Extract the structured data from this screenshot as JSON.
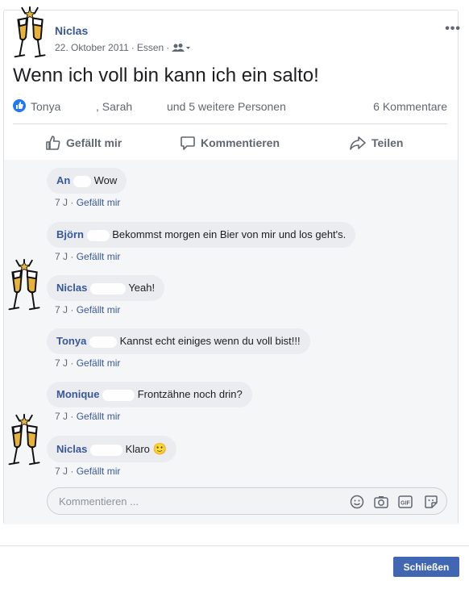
{
  "post": {
    "author": "Niclas",
    "date": "22. Oktober 2011",
    "place": "Essen",
    "audience_icon": "friends-icon",
    "text": "Wenn ich voll bin kann ich ein salto!",
    "more_label": "•••"
  },
  "reactions": {
    "name1": "Tonya",
    "name2": ", Sarah",
    "others": "und 5 weitere Personen",
    "comment_count": "6 Kommentare"
  },
  "actions": {
    "like": "Gefällt mir",
    "comment": "Kommentieren",
    "share": "Teilen"
  },
  "comments": [
    {
      "name": "An",
      "text": "Wow",
      "time": "7 J",
      "like": "Gefällt mir"
    },
    {
      "name": "Björn",
      "text": "Bekommst morgen ein Bier von mir und los geht's.",
      "time": "7 J",
      "like": "Gefällt mir"
    },
    {
      "name": "Niclas",
      "text": "Yeah!",
      "time": "7 J",
      "like": "Gefällt mir"
    },
    {
      "name": "Tonya",
      "text": "Kannst echt einiges wenn du voll bist!!!",
      "time": "7 J",
      "like": "Gefällt mir"
    },
    {
      "name": "Monique",
      "text": "Frontzähne noch drin?",
      "time": "7 J",
      "like": "Gefällt mir"
    },
    {
      "name": "Niclas",
      "text": "Klaro",
      "emoji": "🙂",
      "time": "7 J",
      "like": "Gefällt mir"
    }
  ],
  "composer": {
    "placeholder": "Kommentieren ...",
    "icons": [
      "emoji-icon",
      "camera-icon",
      "gif-icon",
      "sticker-icon"
    ]
  },
  "footer": {
    "close": "Schließen"
  },
  "colors": {
    "link": "#385898",
    "button": "#4267b2",
    "like_badge": "#2078f4"
  }
}
